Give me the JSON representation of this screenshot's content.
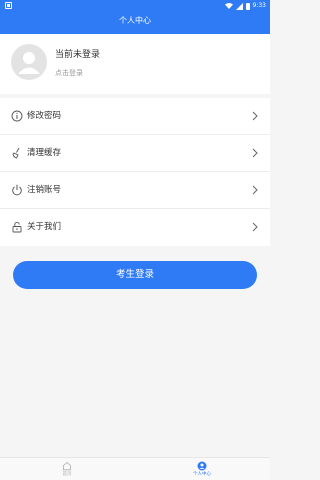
{
  "status_bar": {
    "time": "9:33"
  },
  "header": {
    "title": "个人中心"
  },
  "profile": {
    "name": "当前未登录",
    "subtitle": "点击登录"
  },
  "menu": [
    {
      "label": "修改密码",
      "icon": "info-circle-icon"
    },
    {
      "label": "清理缓存",
      "icon": "broom-icon"
    },
    {
      "label": "注销账号",
      "icon": "power-icon"
    },
    {
      "label": "关于我们",
      "icon": "lock-icon"
    }
  ],
  "login_button": {
    "label": "考生登录"
  },
  "tabbar": {
    "tabs": [
      {
        "label": "首页",
        "icon": "home-icon",
        "active": false
      },
      {
        "label": "个人中心",
        "icon": "user-circle-icon",
        "active": true
      }
    ]
  },
  "colors": {
    "accent": "#2f7bf5",
    "background": "#f5f5f5",
    "text": "#333333",
    "muted": "#999999"
  }
}
